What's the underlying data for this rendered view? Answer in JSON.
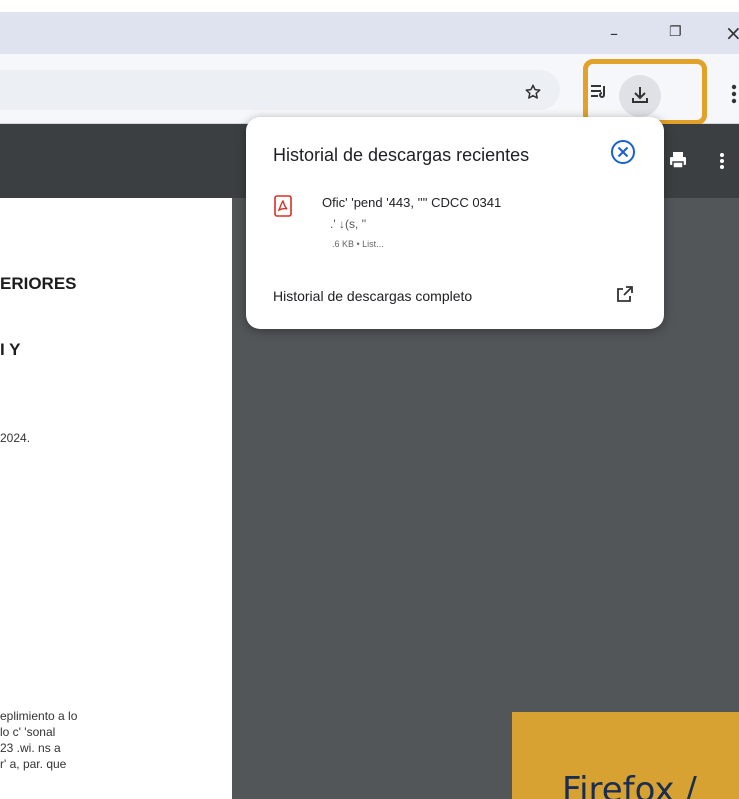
{
  "window": {
    "minimize_glyph": "–",
    "restore_glyph": "❐",
    "close_glyph": "×"
  },
  "toolbar": {
    "bookmark_icon": "star-outline-icon",
    "reading_list_icon": "reading-list-icon",
    "download_icon": "download-icon",
    "menu_icon": "more-vert-icon",
    "highlight_color": "#e2a229"
  },
  "pdf": {
    "lines": [
      "ERIORES",
      "I Y",
      "2024.",
      "eplimiento a lo",
      "lo c'   'sonal",
      "23  .wi.  ns a",
      "r'   a, par.  que"
    ]
  },
  "download_bubble": {
    "title": "Historial de descargas recientes",
    "file": {
      "name": "Ofic'   'pend      '443,  '''' CDCC 0341",
      "name_line2": ".'   ↓(s,  ''",
      "meta": ".6 KB • List..."
    },
    "full_history_label": "Historial de descargas completo"
  },
  "banner": {
    "text": "Firefox /",
    "color": "#d8a232"
  }
}
